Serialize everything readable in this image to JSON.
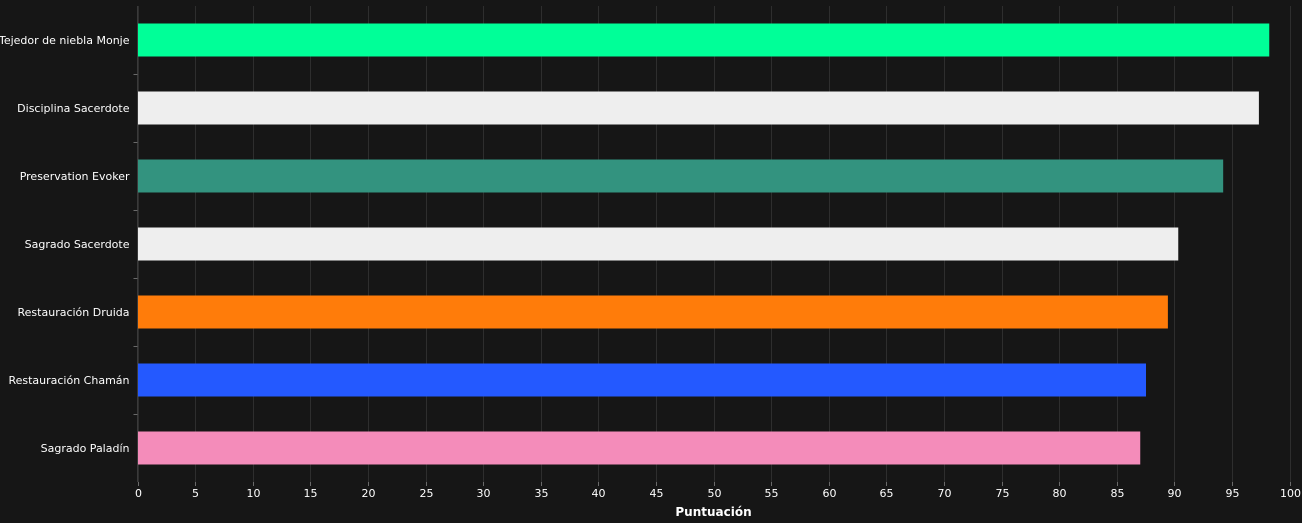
{
  "chart_data": {
    "type": "bar",
    "orientation": "horizontal",
    "title": "",
    "xlabel": "Puntuación",
    "ylabel": "",
    "xlim": [
      0,
      100
    ],
    "x_ticks": [
      0,
      5,
      10,
      15,
      20,
      25,
      30,
      35,
      40,
      45,
      50,
      55,
      60,
      65,
      70,
      75,
      80,
      85,
      90,
      95,
      100
    ],
    "grid": true,
    "legend": "none",
    "categories": [
      "Tejedor de niebla Monje",
      "Disciplina Sacerdote",
      "Preservation Evoker",
      "Sagrado Sacerdote",
      "Restauración Druida",
      "Restauración Chamán",
      "Sagrado Paladín"
    ],
    "values": [
      98.2,
      97.3,
      94.2,
      90.3,
      89.4,
      87.5,
      87.0
    ],
    "colors": [
      "#00ff98",
      "#eeeeee",
      "#33937f",
      "#eeeeee",
      "#ff7c0a",
      "#2459ff",
      "#f48cba"
    ],
    "background": "#161616"
  }
}
